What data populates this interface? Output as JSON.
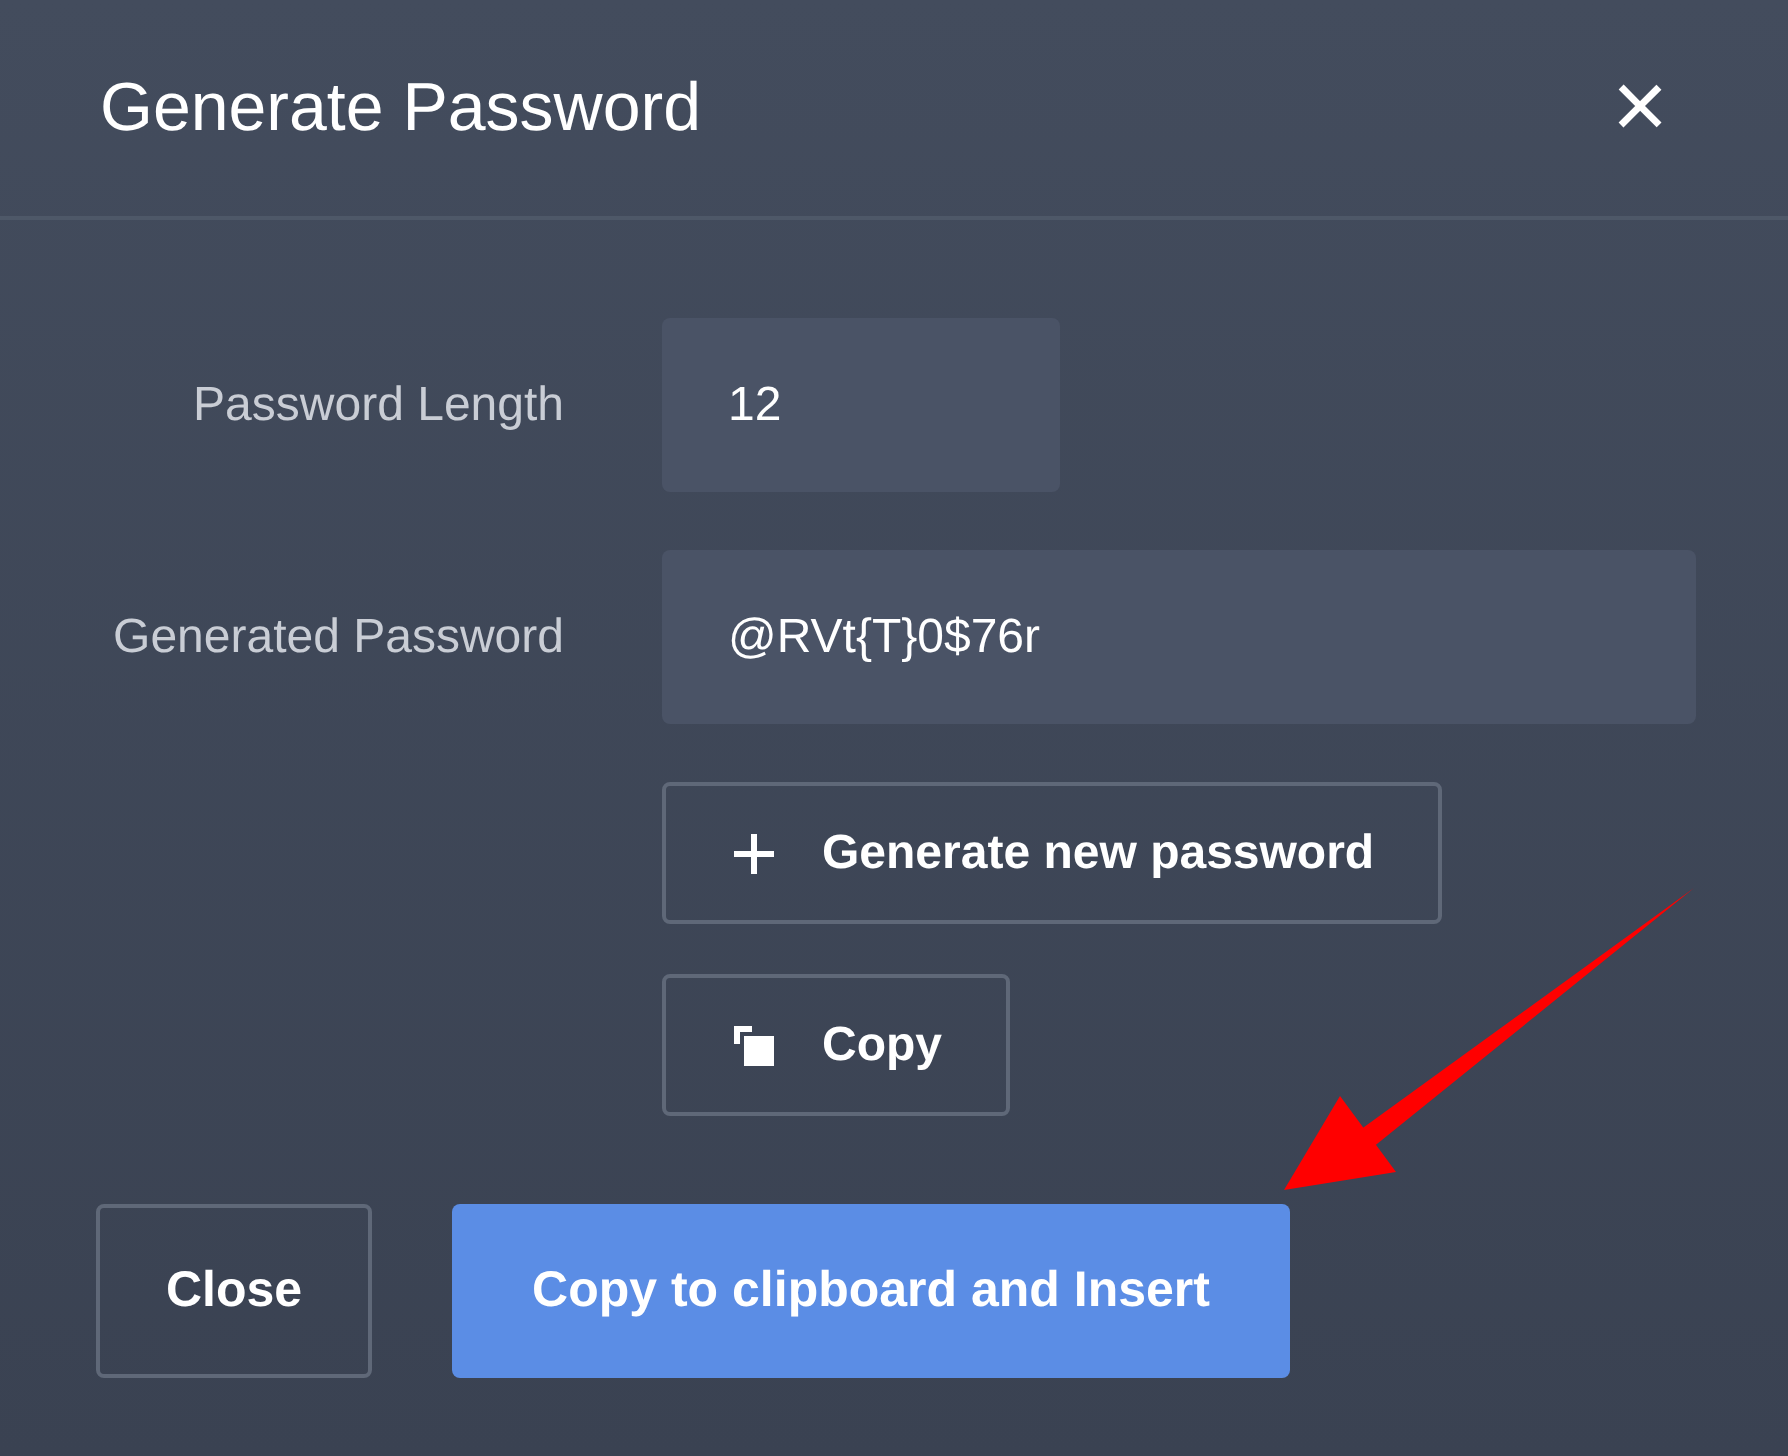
{
  "dialog": {
    "title": "Generate Password",
    "close_icon": "×"
  },
  "fields": [
    {
      "label": "Password Length",
      "value": "12",
      "kind": "short"
    },
    {
      "label": "Generated Password",
      "value": "@RVt{T}0$76r",
      "kind": "wide"
    }
  ],
  "actions": [
    {
      "label": "Generate new password",
      "kind": "plus"
    },
    {
      "label": "Copy",
      "kind": "copy"
    }
  ],
  "footer": [
    {
      "label": "Close",
      "kind": "secondary"
    },
    {
      "label": "Copy to clipboard and Insert",
      "kind": "primary"
    }
  ]
}
